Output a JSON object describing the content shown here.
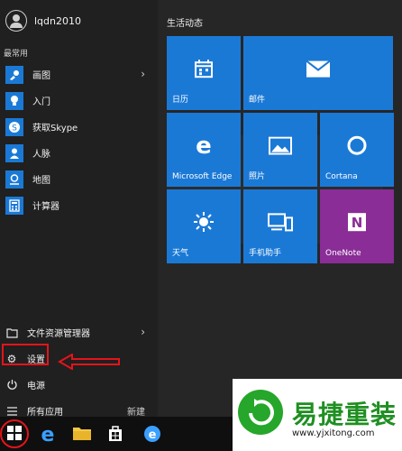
{
  "user": {
    "name": "lqdn2010"
  },
  "most_used_label": "最常用",
  "apps": [
    {
      "label": "画图",
      "icon": "paint-icon",
      "has_submenu": true
    },
    {
      "label": "入门",
      "icon": "lightbulb-icon",
      "has_submenu": false
    },
    {
      "label": "获取Skype",
      "icon": "skype-icon",
      "has_submenu": false
    },
    {
      "label": "人脉",
      "icon": "people-icon",
      "has_submenu": false
    },
    {
      "label": "地图",
      "icon": "maps-icon",
      "has_submenu": false
    },
    {
      "label": "计算器",
      "icon": "calculator-icon",
      "has_submenu": false
    }
  ],
  "bottom_items": [
    {
      "label": "文件资源管理器",
      "icon": "folder-icon",
      "has_submenu": true
    },
    {
      "label": "设置",
      "icon": "gear-icon",
      "has_submenu": false
    },
    {
      "label": "电源",
      "icon": "power-icon",
      "has_submenu": false
    },
    {
      "label": "所有应用",
      "icon": "list-icon",
      "has_submenu": false
    }
  ],
  "all_apps_new": "新建",
  "tiles_group_title": "生活动态",
  "tiles": [
    {
      "label": "日历",
      "icon": "calendar-icon"
    },
    {
      "label": "邮件",
      "icon": "mail-icon"
    },
    {
      "label": "Microsoft Edge",
      "icon": "edge-icon"
    },
    {
      "label": "照片",
      "icon": "photos-icon"
    },
    {
      "label": "Cortana",
      "icon": "cortana-icon"
    },
    {
      "label": "天气",
      "icon": "weather-icon"
    },
    {
      "label": "手机助手",
      "icon": "phone-companion-icon"
    },
    {
      "label": "OneNote",
      "icon": "onenote-icon"
    }
  ],
  "taskbar": {
    "items": [
      "windows-start-icon",
      "edge-icon",
      "file-explorer-icon",
      "store-icon",
      "ie-icon"
    ]
  },
  "watermark": {
    "brand": "易捷重装",
    "url": "www.yjxitong.com"
  },
  "colors": {
    "tile_blue": "#1b79d6",
    "onenote_purple": "#8a2d97",
    "annotation_red": "#e4141b",
    "watermark_green": "#1f8f22"
  }
}
